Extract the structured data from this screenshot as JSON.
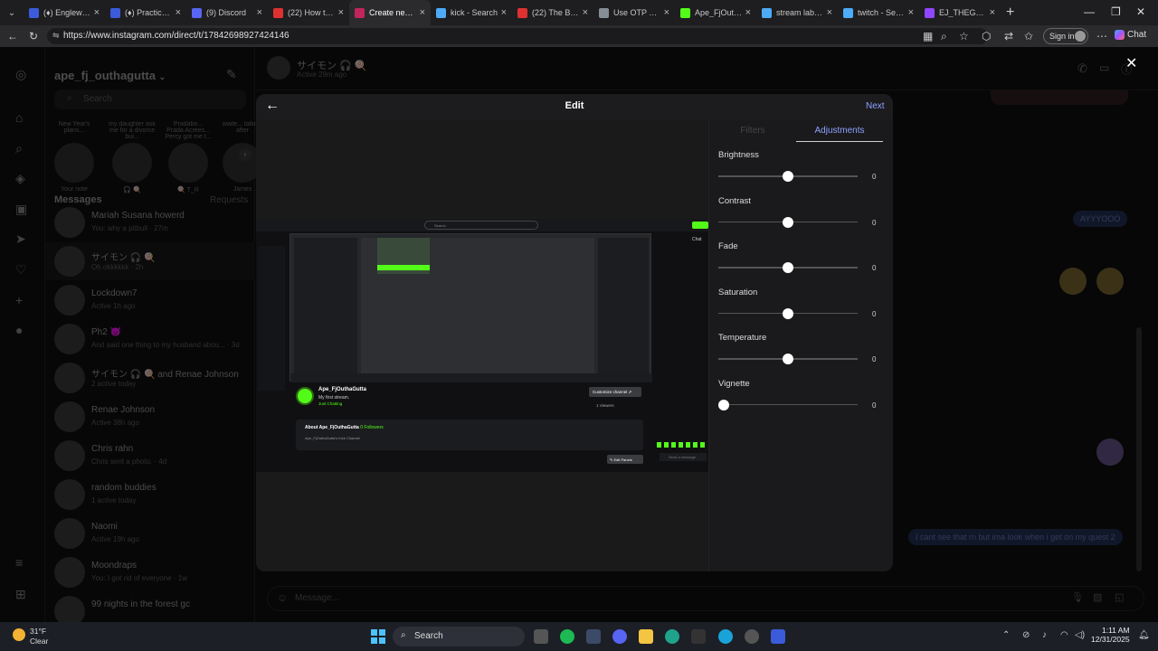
{
  "browser": {
    "tabs": [
      {
        "title": "(♦) Englewoo",
        "color": "#3b5bdb"
      },
      {
        "title": "(♦) Practical B",
        "color": "#3b5bdb"
      },
      {
        "title": "(9) Discord",
        "color": "#5865f2"
      },
      {
        "title": "(22) How to ch",
        "color": "#e03131"
      },
      {
        "title": "Create new po",
        "color": "#c2255c",
        "active": true
      },
      {
        "title": "kick - Search",
        "color": "#4dabf7"
      },
      {
        "title": "(22) The Best S",
        "color": "#e03131"
      },
      {
        "title": "Use OTP To Pr",
        "color": "#868e96"
      },
      {
        "title": "Ape_FjOuthaGu",
        "color": "#53fc18"
      },
      {
        "title": "stream labs - S",
        "color": "#4dabf7"
      },
      {
        "title": "twitch - Search",
        "color": "#4dabf7"
      },
      {
        "title": "EJ_THEGOATGA",
        "color": "#9146ff"
      }
    ],
    "url": "https://www.instagram.com/direct/t/17842698927424146",
    "sign_in": "Sign in",
    "chat": "Chat"
  },
  "sidebar": {
    "username": "ape_fj_outhagutta",
    "search_placeholder": "Search",
    "notes": [
      {
        "text": "New Year's plans...",
        "name": "Your note"
      },
      {
        "text": "my daughter ask me for a divorce bui...",
        "name": "🎧 🍭"
      },
      {
        "text": "Pradabo... Prada Acrees... Percy got me t...",
        "name": "🍭 T_R"
      },
      {
        "text": "waite... talking after",
        "name": "James"
      }
    ],
    "messages_label": "Messages",
    "requests_label": "Requests",
    "conversations": [
      {
        "name": "Mariah Susana howerd",
        "preview": "You: why a pitbull · 27m"
      },
      {
        "name": "サイモン 🎧 🍭",
        "preview": "Oh okkkkkk · 2h",
        "selected": true
      },
      {
        "name": "Lockdown7",
        "preview": "Active 1h ago"
      },
      {
        "name": "Ph2 😈",
        "preview": "And said one thing to my husband abou... · 3d"
      },
      {
        "name": "サイモン 🎧 🍭 and Renae Johnson",
        "preview": "2 active today"
      },
      {
        "name": "Renae Johnson",
        "preview": "Active 38h ago"
      },
      {
        "name": "Chris rahn",
        "preview": "Chris sent a photo. · 4d"
      },
      {
        "name": "random buddies",
        "preview": "1 active today"
      },
      {
        "name": "Naomi",
        "preview": "Active 19h ago"
      },
      {
        "name": "Moondraps",
        "preview": "You: I got rid of everyone · 1w"
      },
      {
        "name": "99 nights in the forest gc",
        "preview": ""
      }
    ]
  },
  "chat": {
    "contact": "サイモン 🎧 🍭",
    "status": "Active 29m ago",
    "bubble1": "AYYYOOO",
    "bubble2": "I cant see that rn but ima look when i get on my quest 2",
    "composer_placeholder": "Message..."
  },
  "modal": {
    "title": "Edit",
    "next": "Next",
    "tabs": {
      "filters": "Filters",
      "adjustments": "Adjustments",
      "active": "adjustments"
    },
    "adjustments": [
      {
        "label": "Brightness",
        "value": "0",
        "level": 0.5
      },
      {
        "label": "Contrast",
        "value": "0",
        "level": 0.5
      },
      {
        "label": "Fade",
        "value": "0",
        "level": 0.5
      },
      {
        "label": "Saturation",
        "value": "0",
        "level": 0.5
      },
      {
        "label": "Temperature",
        "value": "0",
        "level": 0.5
      },
      {
        "label": "Vignette",
        "value": "0",
        "level": 0.0
      }
    ],
    "preview": {
      "channel_name": "Ape_FjOuthaGutta",
      "stream_title": "My first stream.",
      "category": "Just Chatting",
      "customize": "Customize channel ⇗",
      "viewers": "1 Viewers",
      "about": "About Ape_FjOuthaGutta",
      "followers": "0 Followers",
      "bio": "Ape_FjOuthaGutta's Kick Channel",
      "edit_panels": "✎ Edit Panels",
      "send_message": "Send a message",
      "search": "Search",
      "chat": "Chat"
    }
  },
  "taskbar": {
    "temp": "31°F",
    "condition": "Clear",
    "search": "Search",
    "time": "1:11 AM",
    "date": "12/31/2025"
  }
}
